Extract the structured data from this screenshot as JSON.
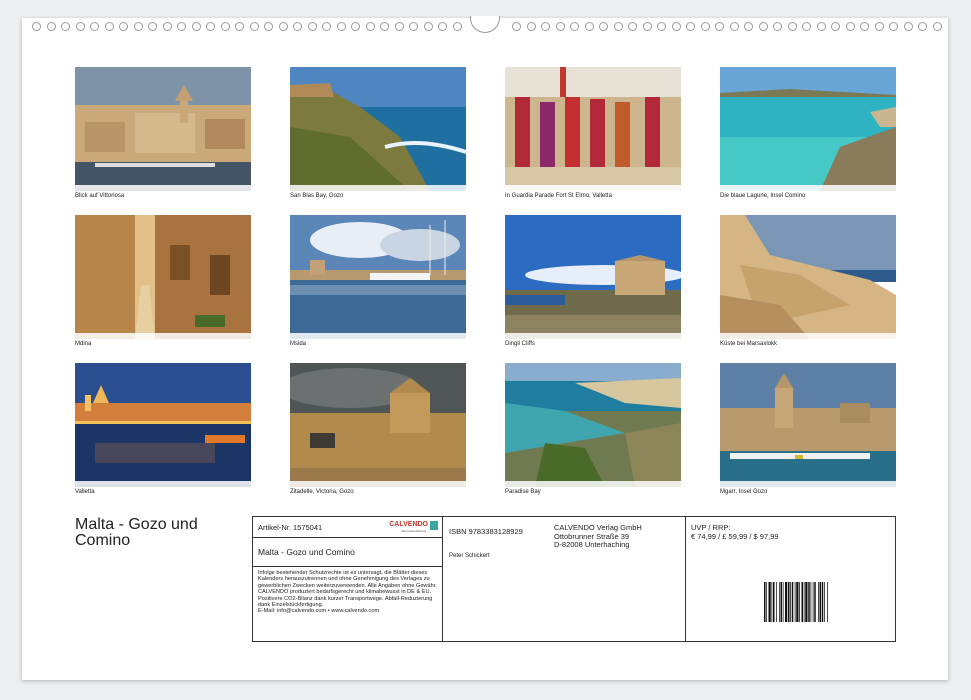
{
  "calendar": {
    "thumbnails": [
      {
        "caption": "Blick auf Vittoriosa",
        "scene": "city"
      },
      {
        "caption": "San Blas Bay, Gozo",
        "scene": "bay"
      },
      {
        "caption": "In Guardia Parade Fort St Elmo, Valletta",
        "scene": "parade"
      },
      {
        "caption": "Die blaue Lagune, Insel Comino",
        "scene": "lagoon"
      },
      {
        "caption": "Mdina",
        "scene": "alley"
      },
      {
        "caption": "Msida",
        "scene": "harbor"
      },
      {
        "caption": "Dingli Cliffs",
        "scene": "cliff"
      },
      {
        "caption": "Küste bei Marsaxlokk",
        "scene": "rocks"
      },
      {
        "caption": "Valletta",
        "scene": "night"
      },
      {
        "caption": "Zitadelle, Victoria, Gozo",
        "scene": "citadel"
      },
      {
        "caption": "Paradise Bay",
        "scene": "paradise"
      },
      {
        "caption": "Mgarr, Insel Gozo",
        "scene": "mgarr"
      }
    ],
    "title": "Malta - Gozo und Comino"
  },
  "info": {
    "article": "Artikel-Nr. 1575041",
    "brand": "CALVENDO",
    "brand_sub": "Das Kalenderhaus",
    "product_title": "Malta - Gozo und Comino",
    "legal": "Infolge bestehender Schutzrechte ist es untersagt, die Blätter dieses Kalenders herauszutrennen und ohne Genehmigung des Verlages zu gewerblichen Zwecken weiterzuverwenden. Alle Angaben ohne Gewähr. CALVENDO produziert bedarfsgerecht und klimabewusst in DE & EU. Positivere CO2-Bilanz dank kurzer Transportwege. Abfall-Reduzierung dank Einzelstückfertigung.",
    "contact": "E-Mail: info@calvendo.com • www.calvendo.com",
    "isbn": "ISBN 9783383128929",
    "author": "Peter Schickert",
    "publisher": [
      "CALVENDO Verlag GmbH",
      "Ottobrunner Straße 39",
      "D-82008 Unterhaching"
    ],
    "price_label": "UVP / RRP:",
    "price": "€ 74,99 / £ 59,99 / $ 97,99"
  },
  "colors": {
    "frame": "#333333",
    "brand": "#c0392b",
    "brand_flag": "#3aa6a0"
  }
}
